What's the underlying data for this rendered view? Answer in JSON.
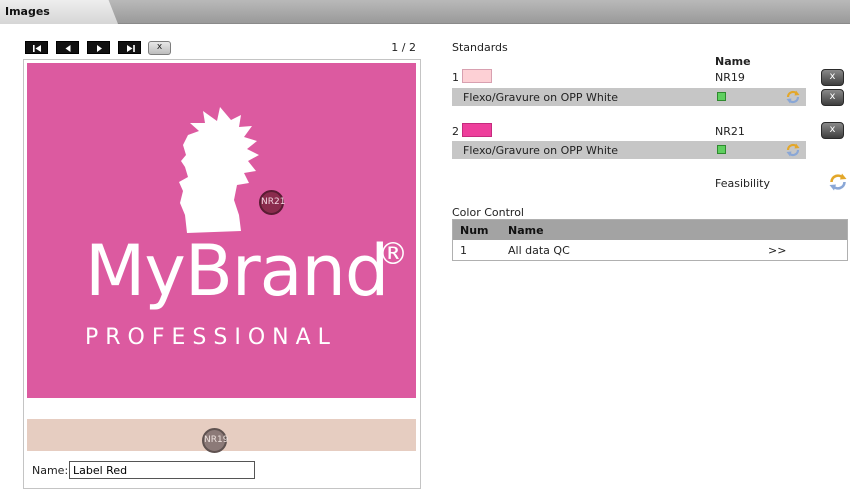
{
  "window": {
    "title": "Images"
  },
  "image_viewer": {
    "pager": "1 / 2",
    "close_label": "x",
    "brand_name": "MyBrand",
    "brand_registered": "®",
    "brand_tagline": "PROFESSIONAL",
    "markers": [
      {
        "label": "NR21"
      },
      {
        "label": "NR19"
      }
    ],
    "name_label": "Name:",
    "name_value": "Label Red"
  },
  "standards": {
    "title": "Standards",
    "name_header": "Name",
    "items": [
      {
        "num": "1",
        "name": "NR19",
        "swatch_color": "#fdd0d5",
        "substrate": "Flexo/Gravure on OPP White"
      },
      {
        "num": "2",
        "name": "NR21",
        "swatch_color": "#ee3f9c",
        "substrate": "Flexo/Gravure on OPP White"
      }
    ],
    "remove_label": "x",
    "feasibility_label": "Feasibility"
  },
  "color_control": {
    "title": "Color Control",
    "columns": [
      "Num",
      "Name"
    ],
    "rows": [
      {
        "num": "1",
        "name": "All data QC",
        "action": ">>"
      }
    ]
  },
  "colors": {
    "image_bg": "#dc5aa0",
    "status_ok": "#5fcf5f"
  }
}
